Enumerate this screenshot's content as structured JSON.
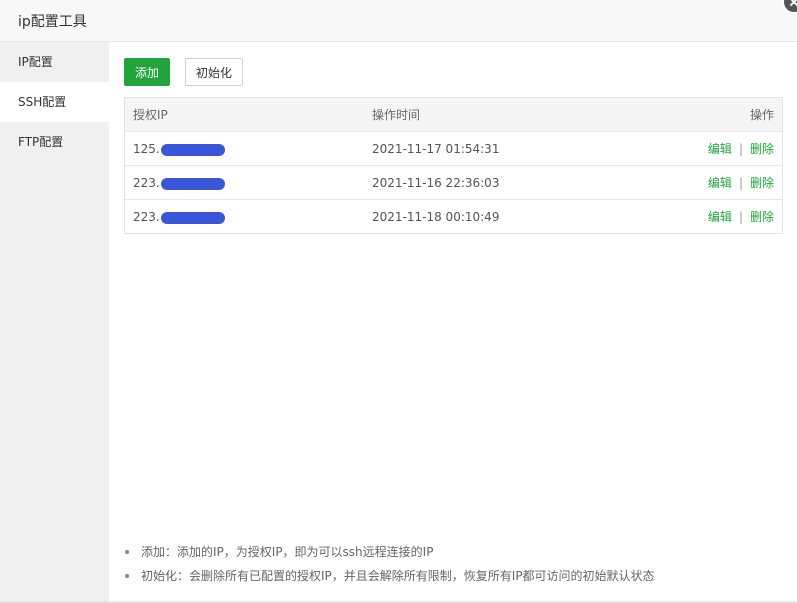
{
  "window": {
    "title": "ip配置工具"
  },
  "sidebar": {
    "items": [
      {
        "label": "IP配置"
      },
      {
        "label": "SSH配置"
      },
      {
        "label": "FTP配置"
      }
    ]
  },
  "toolbar": {
    "add_label": "添加",
    "init_label": "初始化"
  },
  "table": {
    "headers": {
      "ip": "授权IP",
      "time": "操作时间",
      "op": "操作"
    },
    "rows": [
      {
        "ip_prefix": "125.",
        "time": "2021-11-17 01:54:31",
        "edit": "编辑",
        "sep": "|",
        "delete": "删除"
      },
      {
        "ip_prefix": "223.",
        "time": "2021-11-16 22:36:03",
        "edit": "编辑",
        "sep": "|",
        "delete": "删除"
      },
      {
        "ip_prefix": "223.",
        "time": "2021-11-18 00:10:49",
        "edit": "编辑",
        "sep": "|",
        "delete": "删除"
      }
    ]
  },
  "notes": [
    "添加：添加的IP，为授权IP，即为可以ssh远程连接的IP",
    "初始化：会删除所有已配置的授权IP，并且会解除所有限制，恢复所有IP都可访问的初始默认状态"
  ],
  "colors": {
    "accent": "#20a53a",
    "redaction": "#3b55d9"
  }
}
